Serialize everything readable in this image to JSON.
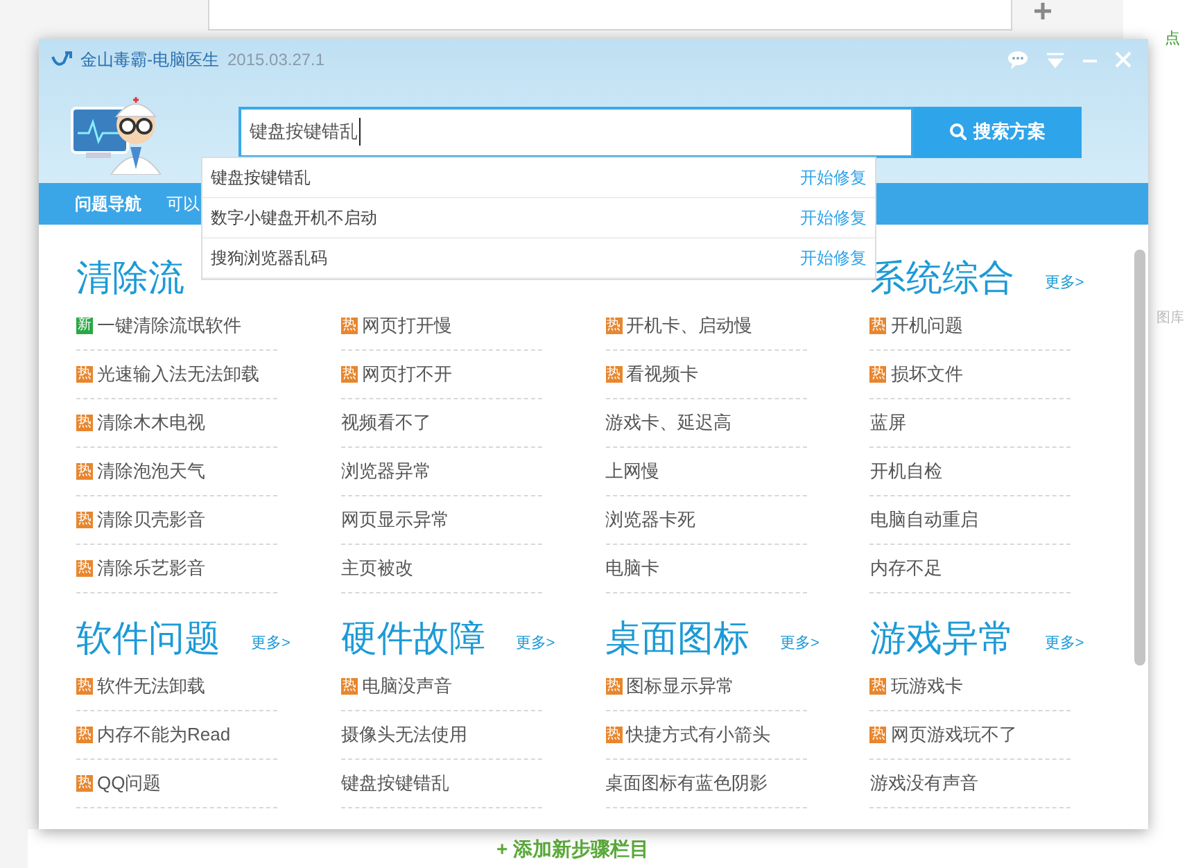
{
  "background_page": {
    "add_step_link": "+ 添加新步骤栏目",
    "right_link": "点",
    "side_label": "图库"
  },
  "window": {
    "app_name": "金山毒霸-电脑医生",
    "version": "2015.03.27.1"
  },
  "search": {
    "value": "键盘按键错乱",
    "button": "搜索方案"
  },
  "suggestions": [
    {
      "text": "键盘按键错乱",
      "action": "开始修复"
    },
    {
      "text": "数字小键盘开机不启动",
      "action": "开始修复"
    },
    {
      "text": "搜狗浏览器乱码",
      "action": "开始修复"
    }
  ],
  "nav": {
    "items": [
      {
        "label": "问题导航",
        "selected": true
      },
      {
        "label": "可以",
        "selected": false
      }
    ]
  },
  "sections": [
    {
      "title": "清除流",
      "items": [
        {
          "text": "一键清除流氓软件",
          "badge": {
            "kind": "new",
            "text": "新"
          }
        },
        {
          "text": "光速输入法无法卸载",
          "badge": {
            "kind": "hot",
            "text": "热"
          }
        },
        {
          "text": "清除木木电视",
          "badge": {
            "kind": "hot",
            "text": "热"
          }
        },
        {
          "text": "清除泡泡天气",
          "badge": {
            "kind": "hot",
            "text": "热"
          }
        },
        {
          "text": "清除贝壳影音",
          "badge": {
            "kind": "hot",
            "text": "热"
          }
        },
        {
          "text": "清除乐艺影音",
          "badge": {
            "kind": "hot",
            "text": "热"
          }
        }
      ]
    },
    {
      "items": [
        {
          "text": "网页打开慢",
          "badge": {
            "kind": "hot",
            "text": "热"
          }
        },
        {
          "text": "网页打不开",
          "badge": {
            "kind": "hot",
            "text": "热"
          }
        },
        {
          "text": "视频看不了"
        },
        {
          "text": "浏览器异常"
        },
        {
          "text": "网页显示异常"
        },
        {
          "text": "主页被改"
        }
      ]
    },
    {
      "items": [
        {
          "text": "开机卡、启动慢",
          "badge": {
            "kind": "hot",
            "text": "热"
          }
        },
        {
          "text": "看视频卡",
          "badge": {
            "kind": "hot",
            "text": "热"
          }
        },
        {
          "text": "游戏卡、延迟高"
        },
        {
          "text": "上网慢"
        },
        {
          "text": "浏览器卡死"
        },
        {
          "text": "电脑卡"
        }
      ]
    },
    {
      "title": "系统综合",
      "more": "更多>",
      "items": [
        {
          "text": "开机问题",
          "badge": {
            "kind": "hot",
            "text": "热"
          }
        },
        {
          "text": "损坏文件",
          "badge": {
            "kind": "hot",
            "text": "热"
          }
        },
        {
          "text": "蓝屏"
        },
        {
          "text": "开机自检"
        },
        {
          "text": "电脑自动重启"
        },
        {
          "text": "内存不足"
        }
      ]
    },
    {
      "title": "软件问题",
      "more": "更多>",
      "items": [
        {
          "text": "软件无法卸载",
          "badge": {
            "kind": "hot",
            "text": "热"
          }
        },
        {
          "text": "内存不能为Read",
          "badge": {
            "kind": "hot",
            "text": "热"
          }
        },
        {
          "text": "QQ问题",
          "badge": {
            "kind": "hot",
            "text": "热"
          }
        }
      ]
    },
    {
      "title": "硬件故障",
      "more": "更多>",
      "items": [
        {
          "text": "电脑没声音",
          "badge": {
            "kind": "hot",
            "text": "热"
          }
        },
        {
          "text": "摄像头无法使用"
        },
        {
          "text": "键盘按键错乱"
        }
      ]
    },
    {
      "title": "桌面图标",
      "more": "更多>",
      "items": [
        {
          "text": "图标显示异常",
          "badge": {
            "kind": "hot",
            "text": "热"
          }
        },
        {
          "text": "快捷方式有小箭头",
          "badge": {
            "kind": "hot",
            "text": "热"
          }
        },
        {
          "text": "桌面图标有蓝色阴影"
        }
      ]
    },
    {
      "title": "游戏异常",
      "more": "更多>",
      "items": [
        {
          "text": "玩游戏卡",
          "badge": {
            "kind": "hot",
            "text": "热"
          }
        },
        {
          "text": "网页游戏玩不了",
          "badge": {
            "kind": "hot",
            "text": "热"
          }
        },
        {
          "text": "游戏没有声音"
        }
      ]
    }
  ]
}
